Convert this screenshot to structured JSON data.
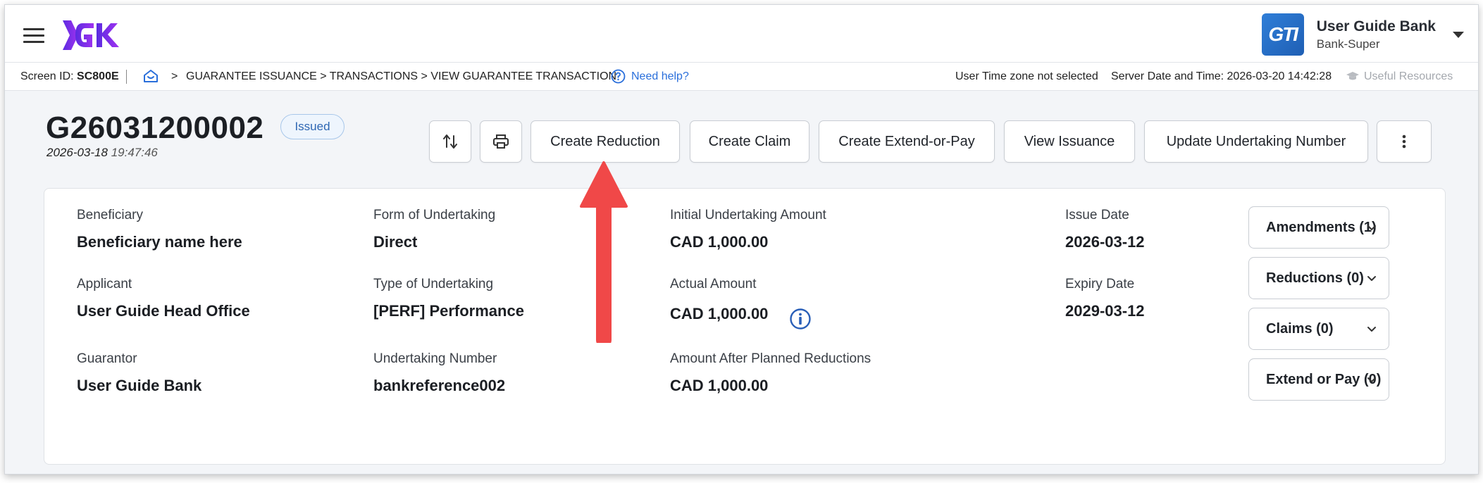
{
  "header": {
    "logo_text": "GTK",
    "user_logo_text": "GTI",
    "user_name": "User Guide Bank",
    "user_role": "Bank-Super"
  },
  "breadcrumb": {
    "screen_id_label": "Screen ID:",
    "screen_id_value": "SC800E",
    "arrow": ">",
    "path": "GUARANTEE ISSUANCE > TRANSACTIONS > VIEW GUARANTEE TRANSACTION",
    "help": "Need help?",
    "timezone": "User Time zone not selected",
    "server_time": "Server Date and Time: 2026-03-20 14:42:28",
    "useful_resources": "Useful Resources"
  },
  "transaction": {
    "id": "G26031200002",
    "date": "2026-03-18",
    "time": "19:47:46",
    "status": "Issued"
  },
  "actions": {
    "sort_icon": "swap-vertical-icon",
    "print_icon": "print-icon",
    "create_reduction": "Create Reduction",
    "create_claim": "Create Claim",
    "create_extend_or_pay": "Create Extend-or-Pay",
    "view_issuance": "View Issuance",
    "update_undertaking_number": "Update Undertaking Number",
    "more_icon": "more-vertical-icon"
  },
  "details": {
    "beneficiary_label": "Beneficiary",
    "beneficiary_value": "Beneficiary name here",
    "applicant_label": "Applicant",
    "applicant_value": "User Guide Head Office",
    "guarantor_label": "Guarantor",
    "guarantor_value": "User Guide Bank",
    "form_label": "Form of Undertaking",
    "form_value": "Direct",
    "type_label": "Type of Undertaking",
    "type_value": "[PERF] Performance",
    "undertaking_number_label": "Undertaking Number",
    "undertaking_number_value": "bankreference002",
    "initial_amount_label": "Initial Undertaking Amount",
    "initial_amount_value": "CAD 1,000.00",
    "actual_amount_label": "Actual Amount",
    "actual_amount_value": "CAD 1,000.00",
    "planned_amount_label": "Amount After Planned Reductions",
    "planned_amount_value": "CAD 1,000.00",
    "issue_date_label": "Issue Date",
    "issue_date_value": "2026-03-12",
    "expiry_date_label": "Expiry Date",
    "expiry_date_value": "2029-03-12"
  },
  "accordions": {
    "amendments": "Amendments (1)",
    "reductions": "Reductions (0)",
    "claims": "Claims (0)",
    "extend_or_pay": "Extend or Pay (0)"
  },
  "colors": {
    "brand_purple": "#7b2ff7",
    "link_blue": "#2a6fdb",
    "annotation_red": "#f04848",
    "badge_blue": "#2e67b3"
  }
}
